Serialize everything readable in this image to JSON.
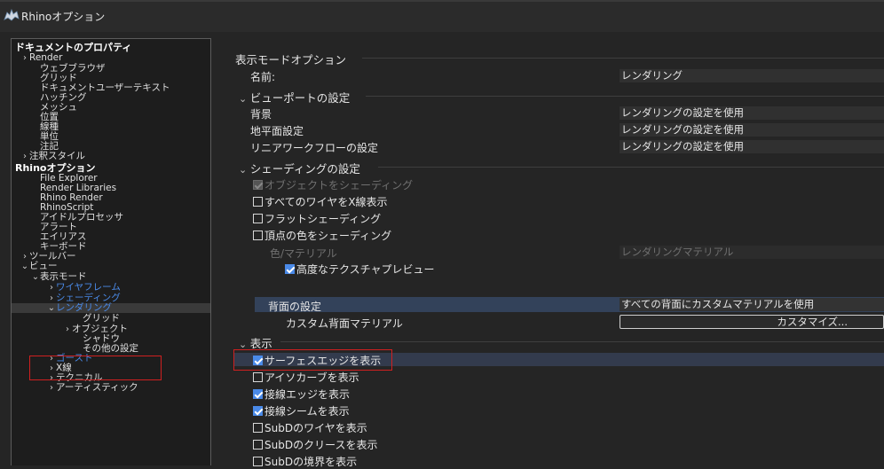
{
  "window": {
    "title": "Rhinoオプション"
  },
  "tree": {
    "items": [
      {
        "label": "ドキュメントのプロパティ",
        "chev": "",
        "bold": true,
        "blue": false
      },
      {
        "label": "Render",
        "chev": "›",
        "bold": false,
        "blue": false
      },
      {
        "label": "ウェブブラウザ",
        "chev": "",
        "bold": false,
        "blue": false
      },
      {
        "label": "グリッド",
        "chev": "",
        "bold": false,
        "blue": false
      },
      {
        "label": "ドキュメントユーザーテキスト",
        "chev": "",
        "bold": false,
        "blue": false
      },
      {
        "label": "ハッチング",
        "chev": "",
        "bold": false,
        "blue": false
      },
      {
        "label": "メッシュ",
        "chev": "",
        "bold": false,
        "blue": false
      },
      {
        "label": "位置",
        "chev": "",
        "bold": false,
        "blue": false
      },
      {
        "label": "線種",
        "chev": "",
        "bold": false,
        "blue": false
      },
      {
        "label": "単位",
        "chev": "",
        "bold": false,
        "blue": false
      },
      {
        "label": "注記",
        "chev": "",
        "bold": false,
        "blue": false
      },
      {
        "label": "注釈スタイル",
        "chev": "›",
        "bold": false,
        "blue": false
      },
      {
        "label": "Rhinoオプション",
        "chev": "",
        "bold": true,
        "blue": false
      },
      {
        "label": "File Explorer",
        "chev": "",
        "bold": false,
        "blue": false
      },
      {
        "label": "Render Libraries",
        "chev": "",
        "bold": false,
        "blue": false
      },
      {
        "label": "Rhino Render",
        "chev": "",
        "bold": false,
        "blue": false
      },
      {
        "label": "RhinoScript",
        "chev": "",
        "bold": false,
        "blue": false
      },
      {
        "label": "アイドルプロセッサ",
        "chev": "",
        "bold": false,
        "blue": false
      },
      {
        "label": "アラート",
        "chev": "",
        "bold": false,
        "blue": false
      },
      {
        "label": "エイリアス",
        "chev": "",
        "bold": false,
        "blue": false
      },
      {
        "label": "キーボード",
        "chev": "",
        "bold": false,
        "blue": false
      },
      {
        "label": "ツールバー",
        "chev": "›",
        "bold": false,
        "blue": false
      },
      {
        "label": "ビュー",
        "chev": "⌄",
        "bold": false,
        "blue": false
      },
      {
        "label": "表示モード",
        "chev": "⌄",
        "bold": false,
        "blue": false
      },
      {
        "label": "ワイヤフレーム",
        "chev": "›",
        "bold": false,
        "blue": true
      },
      {
        "label": "シェーディング",
        "chev": "›",
        "bold": false,
        "blue": true
      },
      {
        "label": "レンダリング",
        "chev": "⌄",
        "bold": false,
        "blue": true
      },
      {
        "label": "グリッド",
        "chev": "",
        "bold": false,
        "blue": false
      },
      {
        "label": "オブジェクト",
        "chev": "›",
        "bold": false,
        "blue": false
      },
      {
        "label": "シャドウ",
        "chev": "",
        "bold": false,
        "blue": false
      },
      {
        "label": "その他の設定",
        "chev": "",
        "bold": false,
        "blue": false
      },
      {
        "label": "ゴースト",
        "chev": "›",
        "bold": false,
        "blue": true
      },
      {
        "label": "X線",
        "chev": "›",
        "bold": false,
        "blue": false
      },
      {
        "label": "テクニカル",
        "chev": "›",
        "bold": false,
        "blue": false
      },
      {
        "label": "アーティスティック",
        "chev": "›",
        "bold": false,
        "blue": false
      }
    ]
  },
  "main": {
    "header": "表示モードオプション",
    "name_label": "名前:",
    "name_value": "レンダリング",
    "viewport_section": "ビューポートの設定",
    "viewport_rows": [
      {
        "label": "背景",
        "value": "レンダリングの設定を使用"
      },
      {
        "label": "地平面設定",
        "value": "レンダリングの設定を使用"
      },
      {
        "label": "リニアワークフローの設定",
        "value": "レンダリングの設定を使用"
      }
    ],
    "shading_section": "シェーディングの設定",
    "shade_objects": "オブジェクトをシェーディング",
    "shading_checks": [
      {
        "label": "すべてのワイヤをX線表示",
        "checked": false
      },
      {
        "label": "フラットシェーディング",
        "checked": false
      },
      {
        "label": "頂点の色をシェーディング",
        "checked": false
      }
    ],
    "color_material_label": "色/マテリアル",
    "color_material_value": "レンダリングマテリアル",
    "advanced_texture": "高度なテクスチャプレビュー",
    "backface_label": "背面の設定",
    "backface_value": "すべての背面にカスタムマテリアルを使用",
    "custom_back_material_label": "カスタム背面マテリアル",
    "customize_button": "カスタマイズ...",
    "display_section": "表示",
    "display_checks": [
      {
        "label": "サーフェスエッジを表示",
        "checked": true
      },
      {
        "label": "アイソカーブを表示",
        "checked": false
      },
      {
        "label": "接線エッジを表示",
        "checked": true
      },
      {
        "label": "接線シームを表示",
        "checked": true
      },
      {
        "label": "SubDのワイヤを表示",
        "checked": false
      },
      {
        "label": "SubDのクリースを表示",
        "checked": false
      },
      {
        "label": "SubDの境界を表示",
        "checked": false
      }
    ]
  }
}
